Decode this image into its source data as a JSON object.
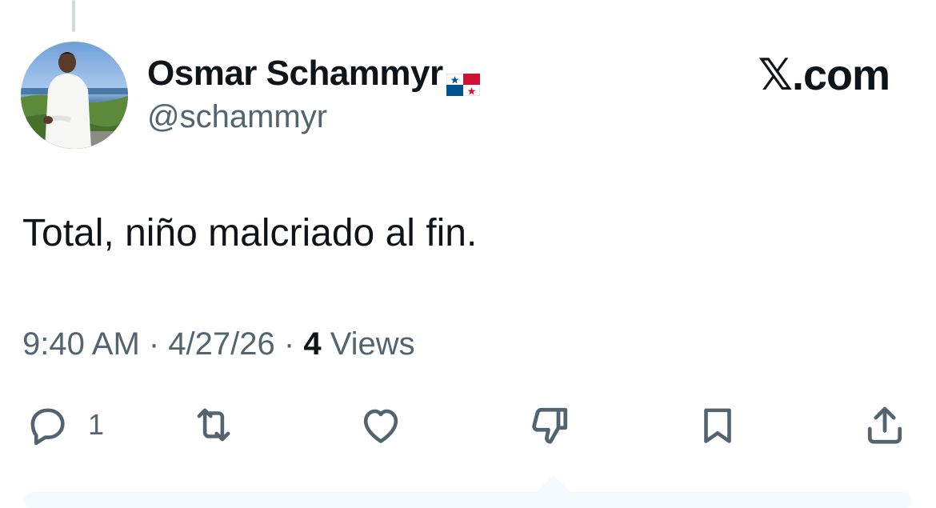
{
  "author": {
    "display_name": "Osmar Schammyr",
    "flag": "panama-flag-icon",
    "handle": "@schammyr",
    "avatar": "profile-photo"
  },
  "brand": "𝕏.com",
  "tweet": {
    "text": "Total, niño malcriado al fin.",
    "time": "9:40 AM",
    "sep1": " · ",
    "date": "4/27/26",
    "sep2": " · ",
    "views_count": "4",
    "views_label": " Views"
  },
  "actions": {
    "reply_icon": "reply-icon",
    "reply_count": "1",
    "retweet_icon": "retweet-icon",
    "like_icon": "heart-icon",
    "dislike_icon": "thumbs-down-icon",
    "bookmark_icon": "bookmark-icon",
    "share_icon": "share-icon"
  },
  "colors": {
    "text": "#0f1419",
    "secondary": "#536471",
    "thread_line": "#cfd9de"
  }
}
